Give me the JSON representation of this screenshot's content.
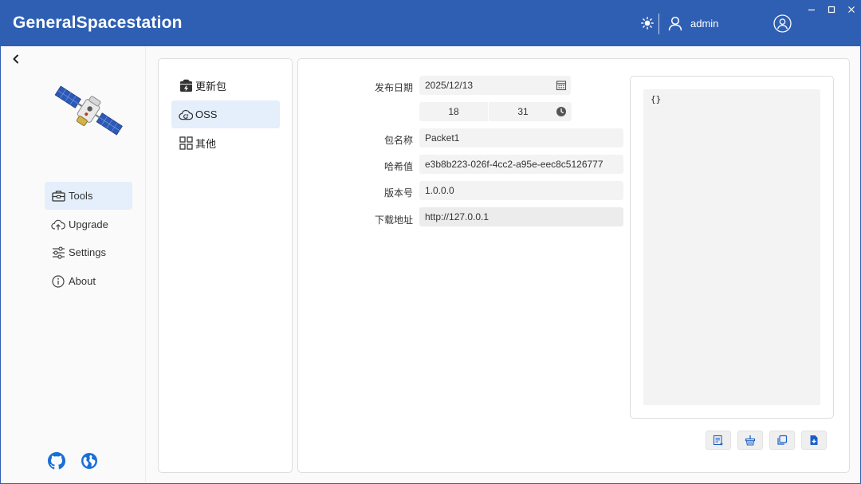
{
  "app": {
    "title": "GeneralSpacestation"
  },
  "header": {
    "user_name": "admin"
  },
  "sidebar": {
    "items": [
      {
        "label": "Tools",
        "icon": "toolbox-icon",
        "active": true
      },
      {
        "label": "Upgrade",
        "icon": "cloud-upload-icon",
        "active": false
      },
      {
        "label": "Settings",
        "icon": "sliders-icon",
        "active": false
      },
      {
        "label": "About",
        "icon": "info-icon",
        "active": false
      }
    ],
    "links": [
      {
        "icon": "github-icon"
      },
      {
        "icon": "globe-icon"
      }
    ]
  },
  "categories": {
    "items": [
      {
        "label": "更新包",
        "icon": "package-icon",
        "active": false
      },
      {
        "label": "OSS",
        "icon": "cloud-sync-icon",
        "active": true
      },
      {
        "label": "其他",
        "icon": "grid-icon",
        "active": false
      }
    ]
  },
  "form": {
    "release_date_label": "发布日期",
    "release_date": "2025/12/13",
    "hour": "18",
    "minute": "31",
    "package_name_label": "包名称",
    "package_name": "Packet1",
    "hash_label": "哈希值",
    "hash": "e3b8b223-026f-4cc2-a95e-eec8c5126777",
    "version_label": "版本号",
    "version": "1.0.0.0",
    "download_url_label": "下载地址",
    "download_url": "http://127.0.0.1"
  },
  "json_preview": {
    "content": "{}"
  },
  "actions": [
    {
      "icon": "generate-icon"
    },
    {
      "icon": "clear-basket-icon"
    },
    {
      "icon": "copy-icon"
    },
    {
      "icon": "save-file-icon"
    }
  ],
  "colors": {
    "titlebar": "#2f5fb3",
    "accent": "#1a6fd6",
    "active_bg": "#e4effb"
  }
}
